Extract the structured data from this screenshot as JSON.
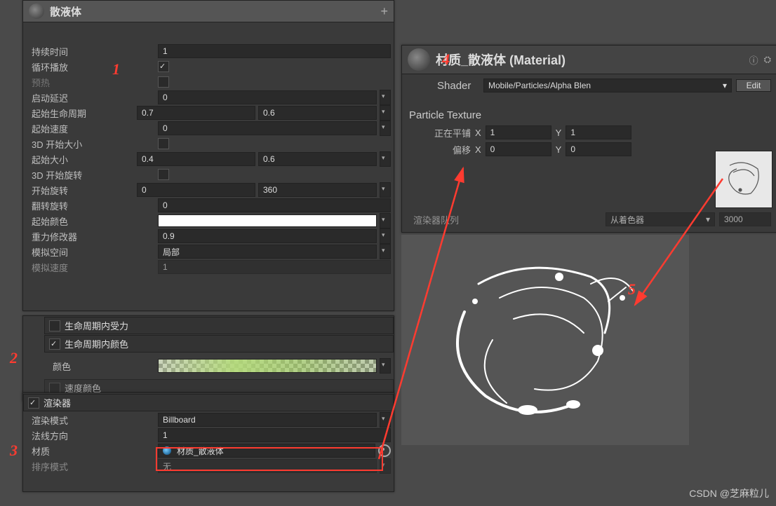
{
  "ps": {
    "title": "散液体",
    "rows": {
      "duration_lbl": "持续时间",
      "duration_val": "1",
      "loop_lbl": "循环播放",
      "prewarm_lbl": "预热",
      "startDelay_lbl": "启动延迟",
      "startDelay_val": "0",
      "startLife_lbl": "起始生命周期",
      "startLife_a": "0.7",
      "startLife_b": "0.6",
      "startSpeed_lbl": "起始速度",
      "startSpeed_val": "0",
      "start3dSize_lbl": "3D 开始大小",
      "startSize_lbl": "起始大小",
      "startSize_a": "0.4",
      "startSize_b": "0.6",
      "start3dRot_lbl": "3D 开始旋转",
      "startRot_lbl": "开始旋转",
      "startRot_a": "0",
      "startRot_b": "360",
      "flipRot_lbl": "翻转旋转",
      "flipRot_val": "0",
      "startColor_lbl": "起始颜色",
      "gravity_lbl": "重力修改器",
      "gravity_val": "0.9",
      "simSpace_lbl": "模拟空间",
      "simSpace_val": "局部",
      "simSpeed_lbl": "模拟速度",
      "simSpeed_val": "1"
    }
  },
  "colorOverLife": {
    "forceSection": "生命周期内受力",
    "section": "生命周期内颜色",
    "color_lbl": "颜色",
    "speedSection": "速度颜色"
  },
  "renderer": {
    "section": "渲染器",
    "mode_lbl": "渲染模式",
    "mode_val": "Billboard",
    "normal_lbl": "法线方向",
    "normal_val": "1",
    "material_lbl": "材质",
    "material_val": "材质_散液体",
    "sort_lbl": "排序模式",
    "sort_val": "无"
  },
  "material": {
    "title": "材质_散液体 (Material)",
    "shader_lbl": "Shader",
    "shader_val": "Mobile/Particles/Alpha Blen",
    "edit_btn": "Edit",
    "texSection": "Particle Texture",
    "tiling_lbl": "正在平铺",
    "tiling_x": "1",
    "tiling_y": "1",
    "offset_lbl": "偏移",
    "offset_x": "0",
    "offset_y": "0",
    "x_lbl": "X",
    "y_lbl": "Y",
    "queue_lbl": "渲染器队列",
    "queue_mode": "从着色器",
    "queue_val": "3000"
  },
  "markers": {
    "m1": "1",
    "m2": "2",
    "m3": "3",
    "m4": "4",
    "m5": "5"
  },
  "watermark": "CSDN @芝麻粒儿"
}
